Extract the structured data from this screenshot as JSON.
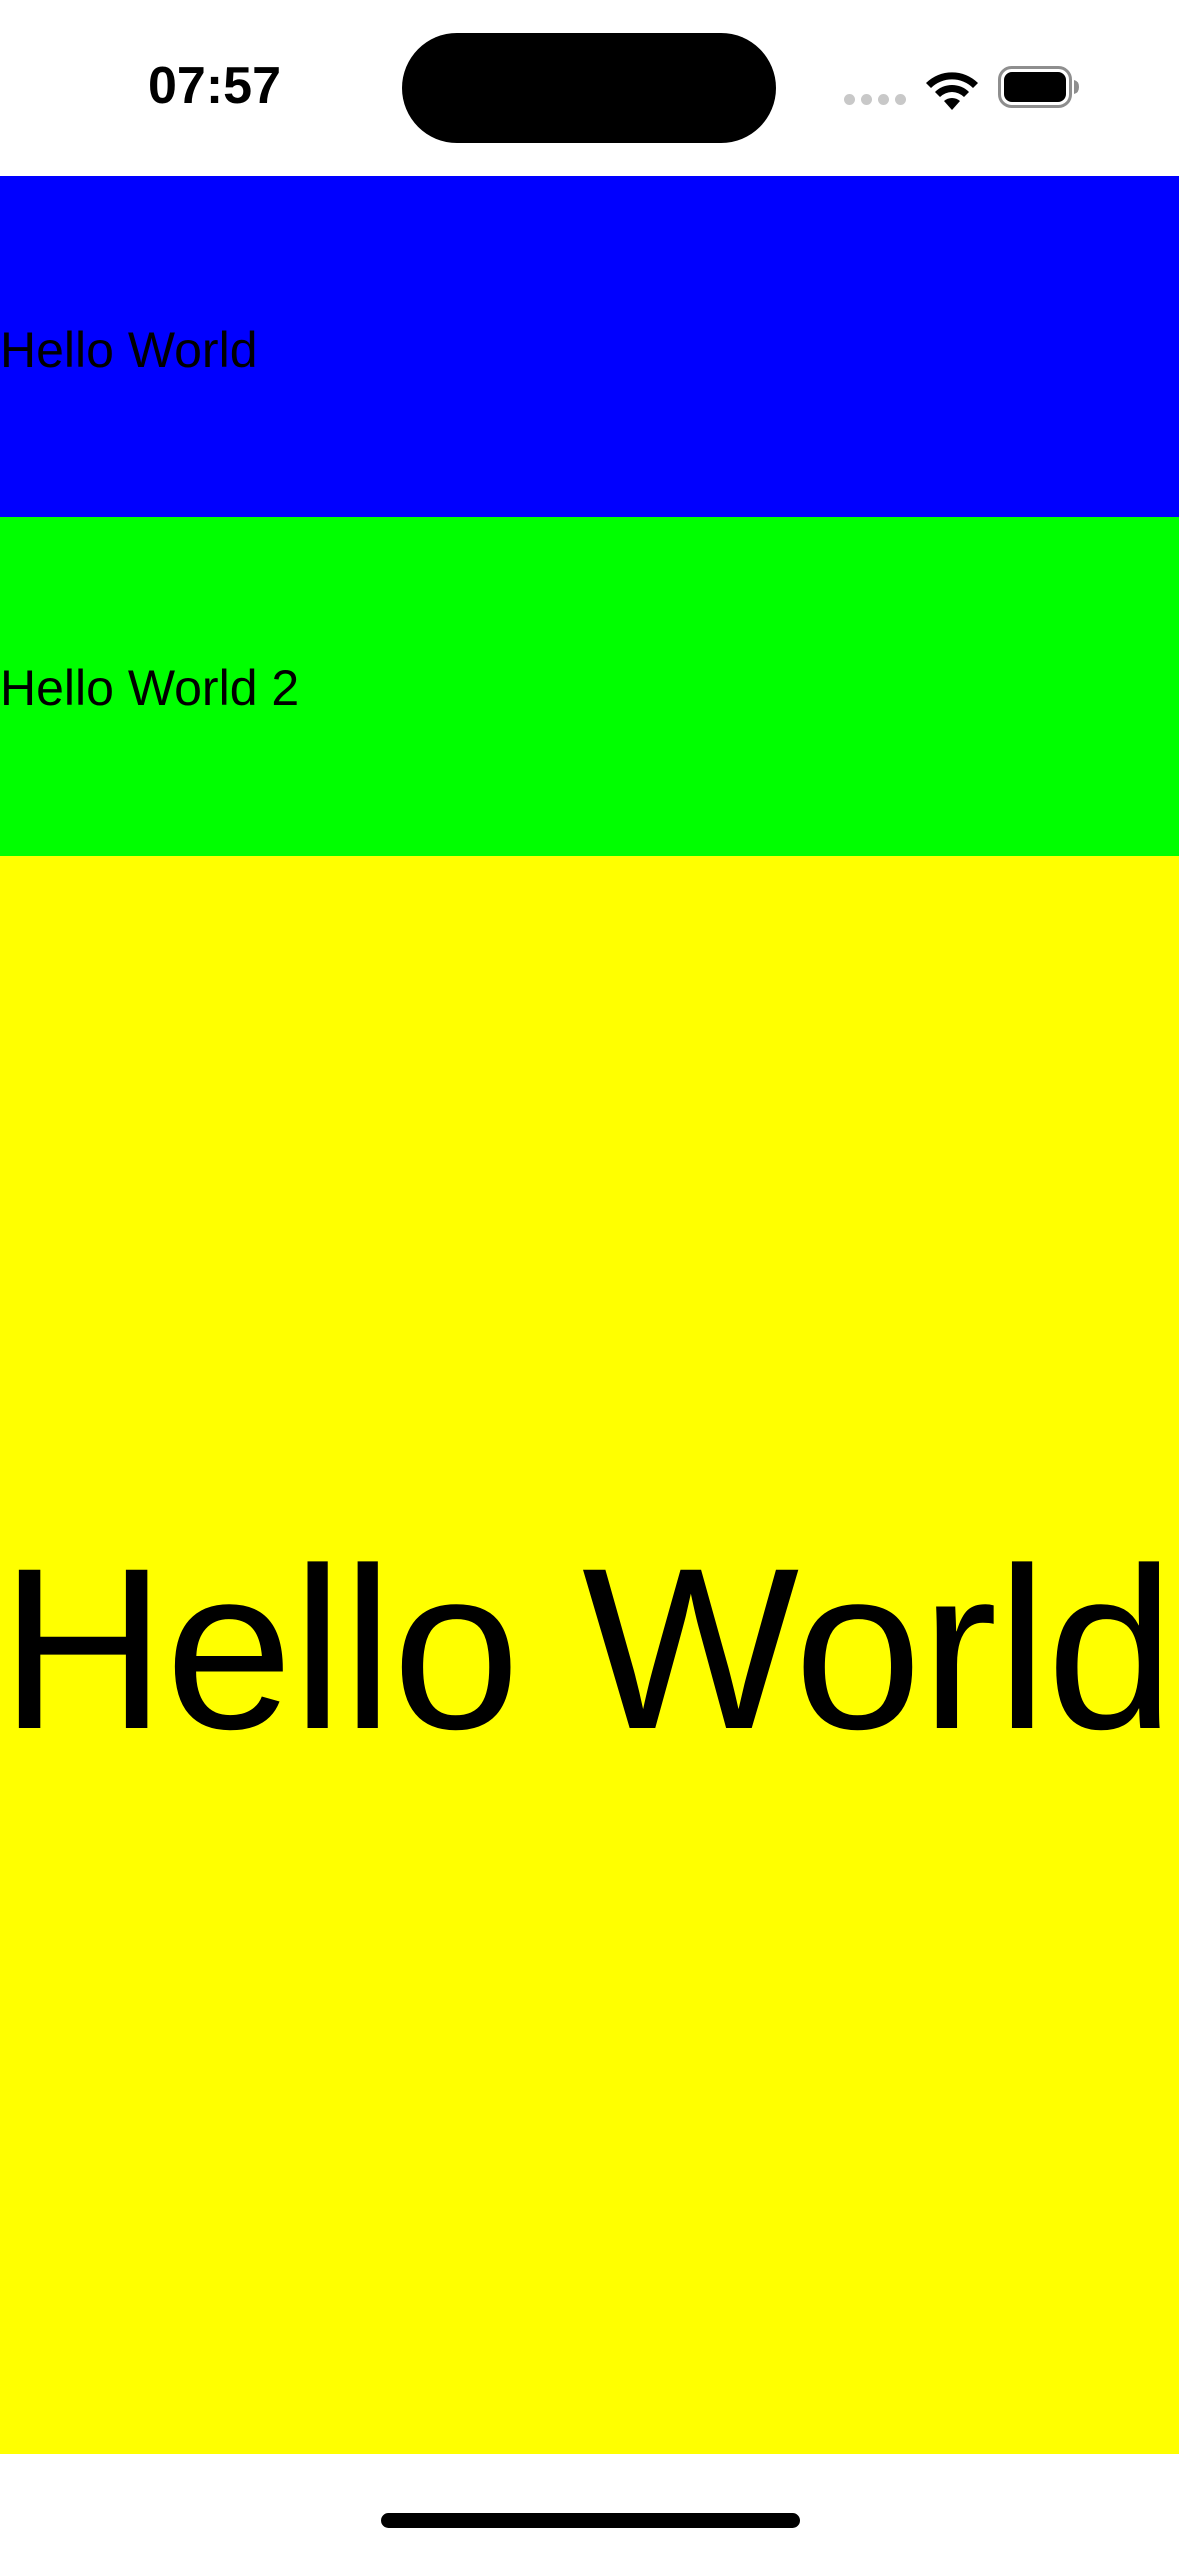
{
  "status_bar": {
    "time": "07:57",
    "icons": [
      "cellular-signal-icon",
      "wifi-icon",
      "battery-icon"
    ]
  },
  "blocks": [
    {
      "label": "Hello World",
      "color": "#0000ff"
    },
    {
      "label": "Hello World 2",
      "color": "#00ff00"
    },
    {
      "label": "Hello World",
      "color": "#ffff00"
    }
  ]
}
